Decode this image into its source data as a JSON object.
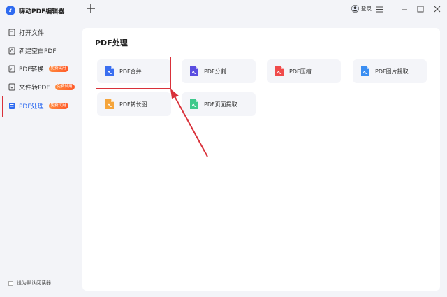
{
  "app": {
    "title": "嗨动PDF编辑器"
  },
  "sidebar": {
    "items": [
      {
        "label": "打开文件",
        "badge": ""
      },
      {
        "label": "新建空白PDF",
        "badge": ""
      },
      {
        "label": "PDF转换",
        "badge": "免费试用"
      },
      {
        "label": "文件转PDF",
        "badge": "免费试用"
      },
      {
        "label": "PDF处理",
        "badge": "免费试用",
        "active": true
      }
    ],
    "footer_checkbox_label": "设为默认阅读器"
  },
  "topbar": {
    "login_label": "登录"
  },
  "panel": {
    "title": "PDF处理",
    "tools": [
      {
        "label": "PDF合并",
        "color": "#3b6ff0"
      },
      {
        "label": "PDF分割",
        "color": "#5a4de0"
      },
      {
        "label": "PDF压缩",
        "color": "#f04b4b"
      },
      {
        "label": "PDF图片提取",
        "color": "#3a8ef2"
      },
      {
        "label": "PDF转长图",
        "color": "#f5a53c"
      },
      {
        "label": "PDF页面提取",
        "color": "#3fc98c"
      }
    ]
  },
  "colors": {
    "accent": "#2f6bf0",
    "highlight": "#d9313a",
    "badge": "#ff6a33"
  }
}
